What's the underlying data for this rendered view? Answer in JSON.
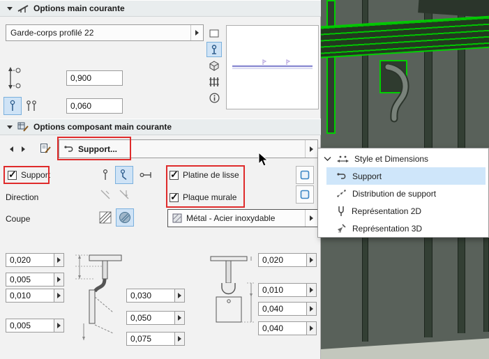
{
  "sections": {
    "main": "Options main courante",
    "component": "Options composant main courante"
  },
  "profile": {
    "value": "Garde-corps profilé 22"
  },
  "fields": {
    "height": "0,900",
    "offset": "0,060"
  },
  "component": {
    "dropdown": "Support...",
    "support": "Support",
    "platine": "Platine de lisse",
    "plaque": "Plaque murale",
    "direction": "Direction",
    "coupe": "Coupe",
    "material": "Métal - Acier inoxydable"
  },
  "dims": {
    "left": [
      "0,020",
      "0,005",
      "0,010",
      "0,005"
    ],
    "mid": [
      "0,030",
      "0,050",
      "0,075"
    ],
    "right": [
      "0,020",
      "0,010",
      "0,040",
      "0,040"
    ]
  },
  "popup": {
    "header": "Style et Dimensions",
    "items": [
      "Support",
      "Distribution de support",
      "Représentation 2D",
      "Représentation 3D"
    ]
  }
}
